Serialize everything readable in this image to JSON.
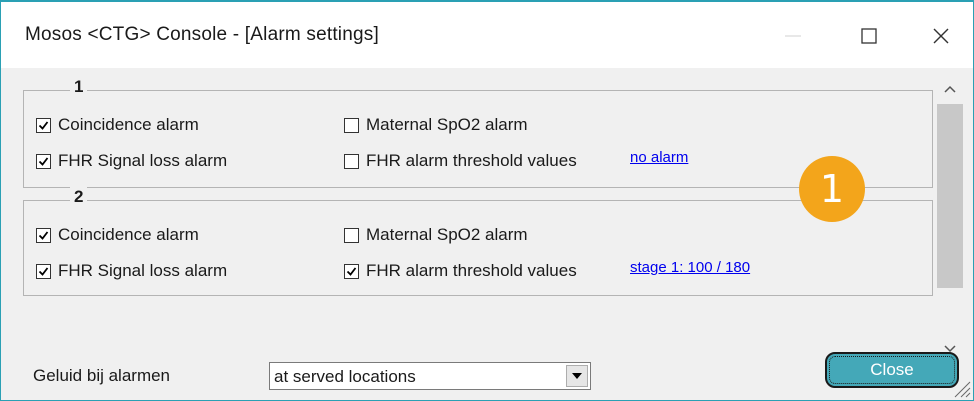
{
  "window": {
    "title": "Mosos <CTG> Console - [Alarm settings]",
    "border_color": "#2aa0b4"
  },
  "titlebar_controls": [
    "minimize-icon",
    "maximize-icon",
    "close-icon"
  ],
  "groups": [
    {
      "label": "1",
      "left": [
        {
          "label": "Coincidence alarm",
          "checked": true
        },
        {
          "label": "FHR Signal loss alarm",
          "checked": true
        }
      ],
      "right": [
        {
          "label": "Maternal SpO2 alarm",
          "checked": false
        },
        {
          "label": "FHR alarm threshold values",
          "checked": false
        }
      ],
      "threshold_link": "no alarm"
    },
    {
      "label": "2",
      "left": [
        {
          "label": "Coincidence alarm",
          "checked": true
        },
        {
          "label": "FHR Signal loss alarm",
          "checked": true
        }
      ],
      "right": [
        {
          "label": "Maternal SpO2 alarm",
          "checked": false
        },
        {
          "label": "FHR alarm threshold values",
          "checked": true
        }
      ],
      "threshold_link": "stage 1: 100 / 180"
    }
  ],
  "callout_badge": {
    "text": "1",
    "color": "#f3a51b"
  },
  "sound": {
    "label": "Geluid bij alarmen",
    "selected": "at served locations"
  },
  "close_button": {
    "label": "Close",
    "color": "#44a8b8"
  }
}
